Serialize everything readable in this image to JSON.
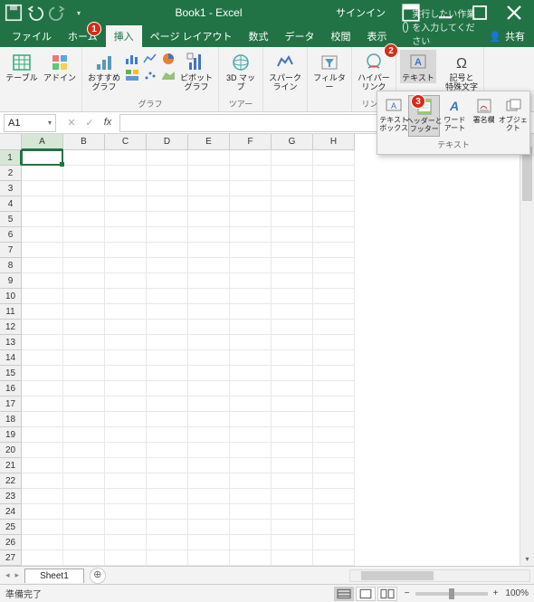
{
  "titlebar": {
    "title": "Book1 - Excel",
    "signin": "サインイン"
  },
  "tabs": {
    "file": "ファイル",
    "home": "ホーム",
    "insert": "挿入",
    "page_layout": "ページ レイアウト",
    "formulas": "数式",
    "data": "データ",
    "review": "校閲",
    "view": "表示",
    "tell_me": "実行したい作業を入力してください",
    "share": "共有"
  },
  "ribbon": {
    "tables": {
      "table": "テーブル",
      "addin": "アドイン"
    },
    "charts": {
      "recommended": "おすすめ\nグラフ",
      "pivot": "ピボットグラフ",
      "label": "グラフ"
    },
    "tours": {
      "map": "3D マップ",
      "label": "ツアー"
    },
    "sparklines": "スパークライン",
    "filters": "フィルター",
    "links": {
      "hyperlink": "ハイパーリンク",
      "label": "リンク"
    },
    "text": {
      "text": "テキスト"
    },
    "symbols": {
      "label": "記号と\n特殊文字"
    }
  },
  "dropdown": {
    "textbox": "テキスト\nボックス",
    "header_footer": "ヘッダーと\nフッター",
    "wordart": "ワード\nアート",
    "sigline": "署名欄",
    "object": "オブジェクト",
    "label": "テキスト"
  },
  "formula_bar": {
    "name_box": "A1"
  },
  "columns": [
    "A",
    "B",
    "C",
    "D",
    "E",
    "F",
    "G",
    "H"
  ],
  "rows": [
    "1",
    "2",
    "3",
    "4",
    "5",
    "6",
    "7",
    "8",
    "9",
    "10",
    "11",
    "12",
    "13",
    "14",
    "15",
    "16",
    "17",
    "18",
    "19",
    "20",
    "21",
    "22",
    "23",
    "24",
    "25",
    "26",
    "27"
  ],
  "sheet": {
    "name": "Sheet1"
  },
  "status": {
    "ready": "準備完了",
    "zoom": "100%"
  },
  "badges": {
    "b1": "1",
    "b2": "2",
    "b3": "3"
  }
}
